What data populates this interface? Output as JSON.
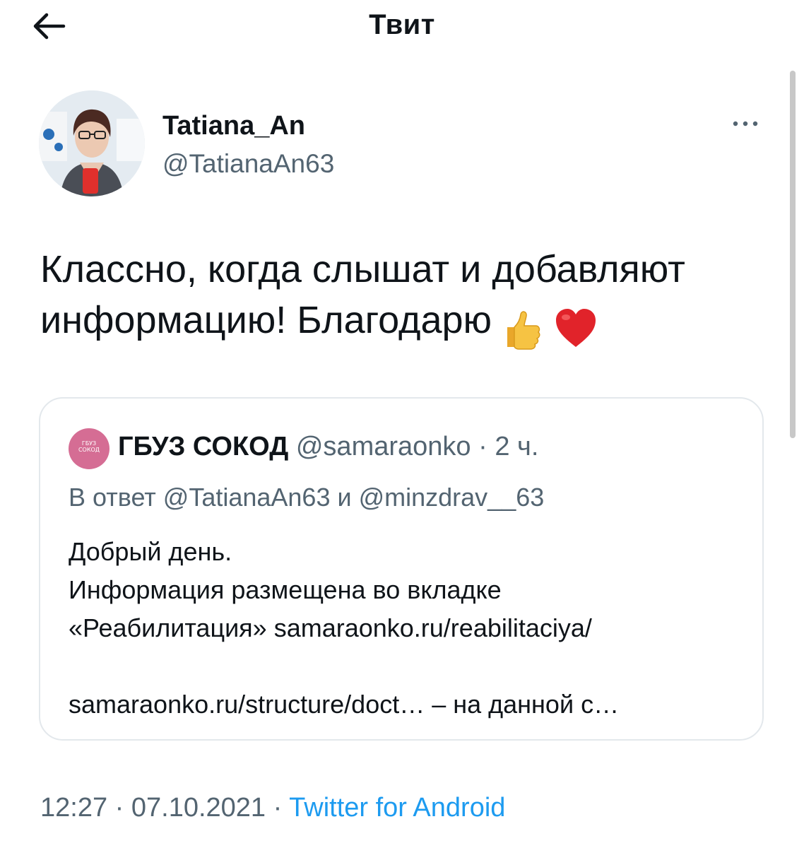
{
  "header": {
    "title": "Твит"
  },
  "tweet": {
    "author_name": "Tatiana_An",
    "author_handle": "@TatianaAn63",
    "text_line1": "Классно, когда слышат и добавляют",
    "text_line2": "информацию! Благодарю",
    "emojis": [
      "thumbs-up",
      "red-heart"
    ]
  },
  "quote": {
    "avatar_text_1": "ГБУЗ",
    "avatar_text_2": "СОКОД",
    "author_name": "ГБУЗ СОКОД",
    "author_handle": "@samaraonko",
    "separator": "·",
    "time": "2 ч.",
    "reply_to": "В ответ @TatianaAn63 и @minzdrav__63",
    "body_lines": [
      "Добрый день.",
      "Информация размещена во вкладке",
      "«Реабилитация» samaraonko.ru/reabilitaciya/",
      "",
      "samaraonko.ru/structure/doct… – на данной с…"
    ]
  },
  "footer": {
    "time": "12:27",
    "separator": "·",
    "date": "07.10.2021",
    "source": "Twitter for Android"
  },
  "colors": {
    "text_primary": "#0f1419",
    "text_secondary": "#536471",
    "link": "#1d9bf0",
    "card_border": "#e3e8ec",
    "quote_avatar_bg": "#d56d94"
  }
}
